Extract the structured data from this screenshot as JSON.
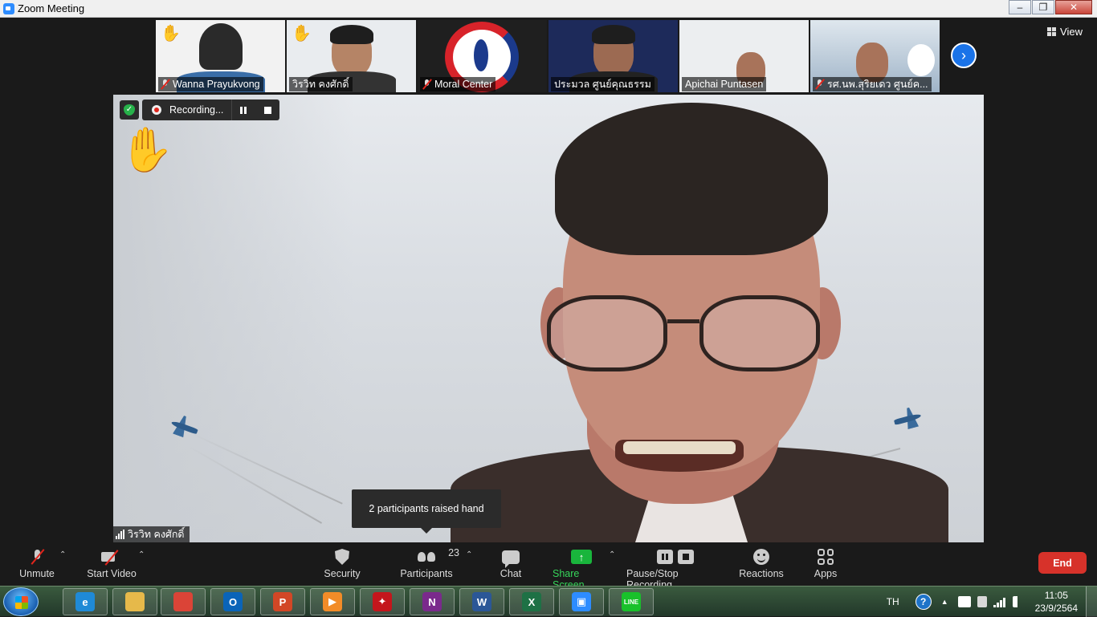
{
  "window": {
    "title": "Zoom Meeting",
    "buttons": [
      "–",
      "❐",
      "✕"
    ]
  },
  "view_button": {
    "label": "View"
  },
  "thumbnails": [
    {
      "name": "Wanna Prayukvong",
      "muted": true,
      "hand_raised": true,
      "bg": "#f2f2f2",
      "active": false
    },
    {
      "name": "วิรวิท  คงศักดิ์",
      "muted": false,
      "hand_raised": true,
      "bg": "#e9ecef",
      "active": true
    },
    {
      "name": "Moral Center",
      "muted": true,
      "hand_raised": false,
      "bg": "#1f1f1f",
      "active": false
    },
    {
      "name": "ประมวล ศูนย์คุณธรรม",
      "muted": false,
      "hand_raised": false,
      "bg": "#1d2a5a",
      "active": false
    },
    {
      "name": "Apichai Puntasen",
      "muted": false,
      "hand_raised": false,
      "bg": "#eceef0",
      "active": false
    },
    {
      "name": "รศ.นพ.สุริยเดว ศูนย์ค...",
      "muted": true,
      "hand_raised": false,
      "bg": "#9fb4c8",
      "active": false
    }
  ],
  "next_icon": "chevron-right-icon",
  "recording": {
    "label": "Recording..."
  },
  "main": {
    "speaker": "วิรวิท  คงศักดิ์",
    "raised_hand_icon": "✋",
    "tooltip": "2 participants raised hand"
  },
  "toolbar": {
    "unmute": "Unmute",
    "start_video": "Start Video",
    "security": "Security",
    "participants": "Participants",
    "participants_count": "23",
    "chat": "Chat",
    "share_screen": "Share Screen",
    "pause_stop": "Pause/Stop Recording",
    "reactions": "Reactions",
    "apps": "Apps",
    "end": "End"
  },
  "taskbar": {
    "apps": [
      {
        "name": "ie-icon",
        "glyph": "e",
        "color": "#1f8ad6"
      },
      {
        "name": "explorer-icon",
        "glyph": "",
        "color": "#e6b94a"
      },
      {
        "name": "chrome-icon",
        "glyph": "",
        "color": "#db4437"
      },
      {
        "name": "outlook-icon",
        "glyph": "O",
        "color": "#0a64b8"
      },
      {
        "name": "powerpoint-icon",
        "glyph": "P",
        "color": "#d24726"
      },
      {
        "name": "video-player-icon",
        "glyph": "▶",
        "color": "#f28c28"
      },
      {
        "name": "app-red-icon",
        "glyph": "✦",
        "color": "#c4161c"
      },
      {
        "name": "onenote-icon",
        "glyph": "N",
        "color": "#7a2a8c"
      },
      {
        "name": "word-icon",
        "glyph": "W",
        "color": "#2b5797"
      },
      {
        "name": "excel-icon",
        "glyph": "X",
        "color": "#1e7145"
      },
      {
        "name": "zoom-icon",
        "glyph": "▣",
        "color": "#2d8cff"
      },
      {
        "name": "line-icon",
        "glyph": "LINE",
        "color": "#19c12b"
      }
    ],
    "language": "TH",
    "time": "11:05",
    "date": "23/9/2564"
  }
}
